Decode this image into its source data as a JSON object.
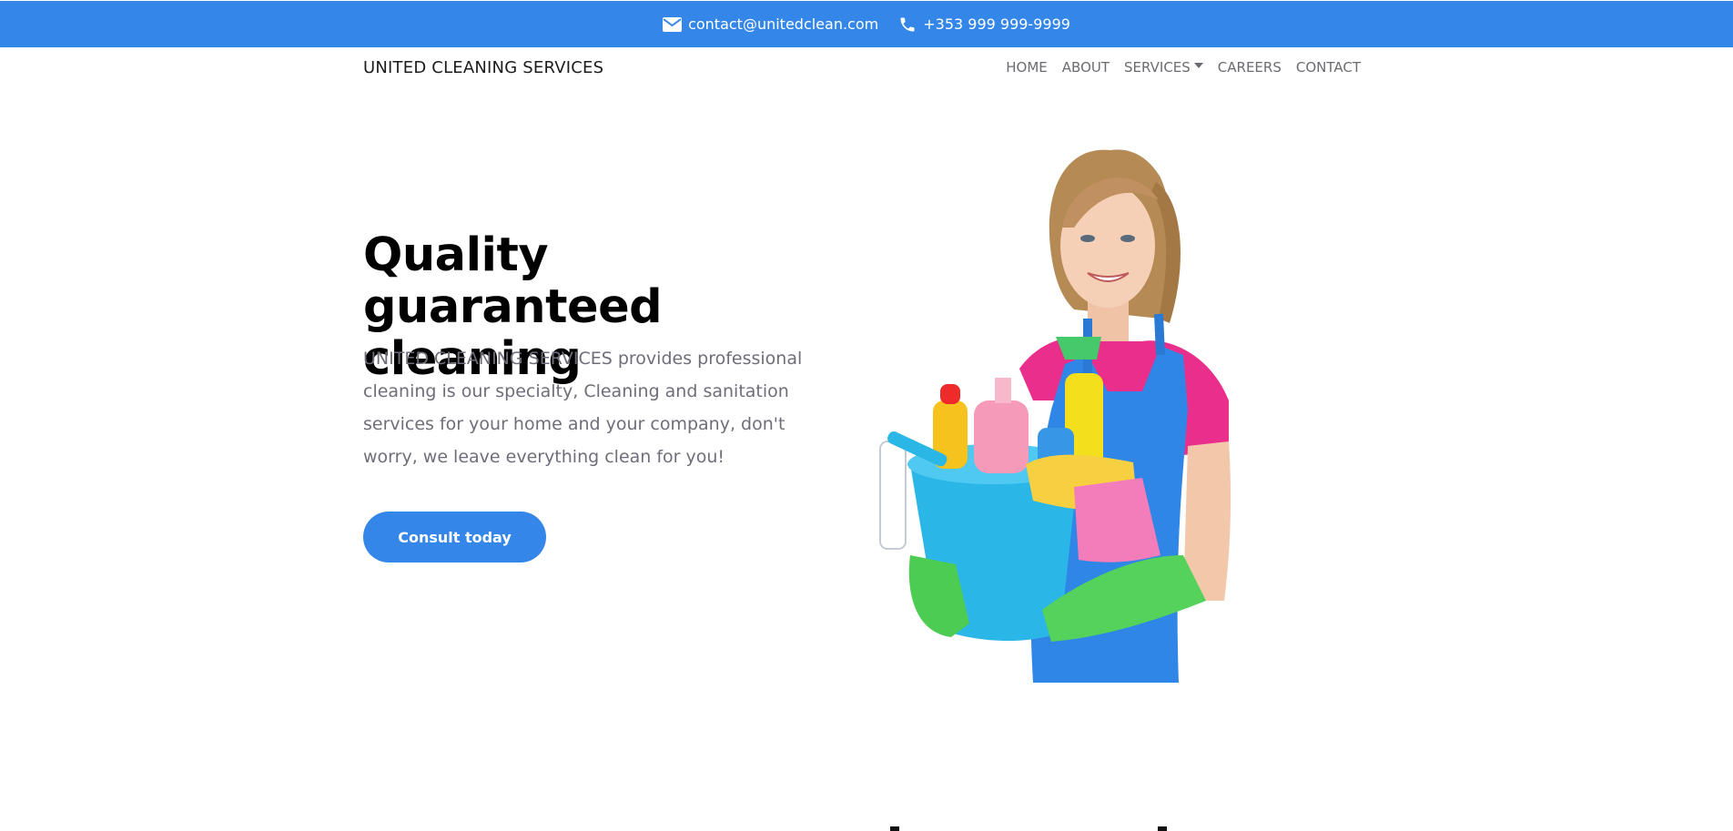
{
  "topbar": {
    "email_icon": "envelope-icon",
    "email": "contact@unitedclean.com",
    "phone_icon": "phone-icon",
    "phone": "+353 999 999-9999"
  },
  "navbar": {
    "brand": "UNITED CLEANING SERVICES",
    "links": [
      {
        "label": "HOME"
      },
      {
        "label": "ABOUT"
      },
      {
        "label": "SERVICES",
        "has_dropdown": true
      },
      {
        "label": "CAREERS"
      },
      {
        "label": "CONTACT"
      }
    ]
  },
  "hero": {
    "title_line1": "Quality guaranteed",
    "title_line2": "cleaning",
    "description": "UNITED CLEANING SERVICES provides professional cleaning is our specialty, Cleaning and sanitation services for your home and your company, don't worry, we leave everything clean for you!",
    "cta_label": "Consult today",
    "image": "woman-holding-cleaning-supplies"
  },
  "colors": {
    "accent": "#3487e8",
    "heading": "#000000",
    "body_text": "#6e6e7a",
    "nav_text": "#6b6b72"
  }
}
